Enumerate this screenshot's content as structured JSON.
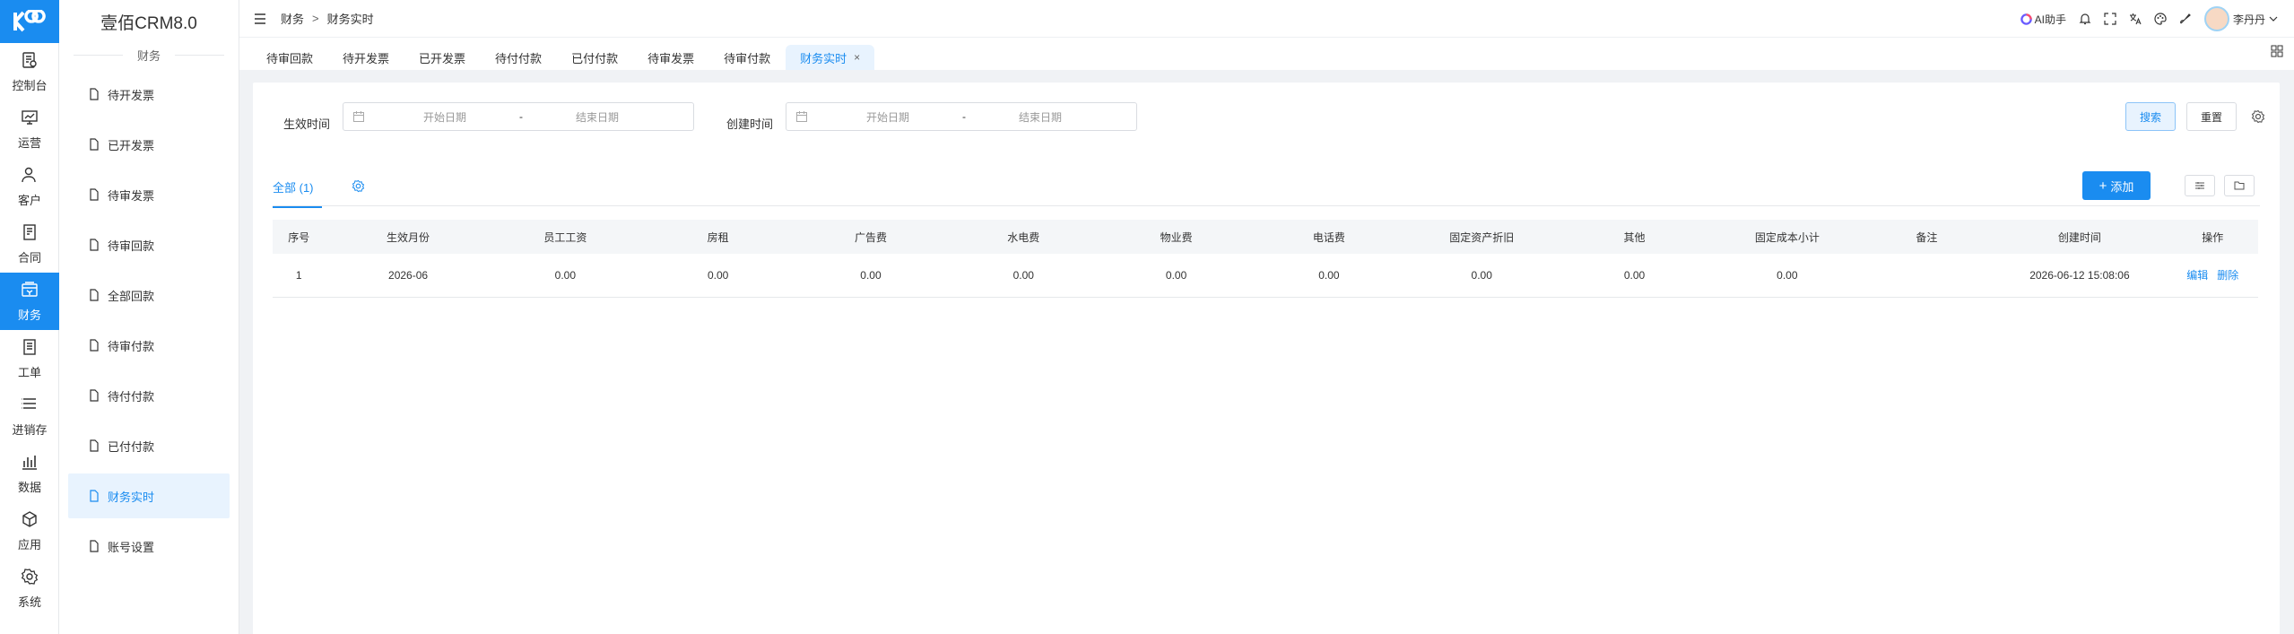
{
  "rail": {
    "items": [
      {
        "label": "控制台",
        "icon": "dashboard-icon"
      },
      {
        "label": "运营",
        "icon": "operations-icon"
      },
      {
        "label": "客户",
        "icon": "customer-icon"
      },
      {
        "label": "合同",
        "icon": "contract-icon"
      },
      {
        "label": "财务",
        "icon": "finance-icon",
        "active": true
      },
      {
        "label": "工单",
        "icon": "ticket-icon"
      },
      {
        "label": "进销存",
        "icon": "inventory-icon"
      },
      {
        "label": "数据",
        "icon": "data-icon"
      },
      {
        "label": "应用",
        "icon": "apps-icon"
      },
      {
        "label": "系统",
        "icon": "system-icon"
      }
    ]
  },
  "sub": {
    "brand": "壹佰CRM8.0",
    "title": "财务",
    "items": [
      {
        "label": "待开发票"
      },
      {
        "label": "已开发票"
      },
      {
        "label": "待审发票"
      },
      {
        "label": "待审回款"
      },
      {
        "label": "全部回款"
      },
      {
        "label": "待审付款"
      },
      {
        "label": "待付付款"
      },
      {
        "label": "已付付款"
      },
      {
        "label": "财务实时",
        "active": true
      },
      {
        "label": "账号设置"
      }
    ]
  },
  "header": {
    "breadcrumb": [
      "财务",
      "财务实时"
    ],
    "breadcrumb_sep": ">",
    "ai_label": "AI助手",
    "user_name": "李丹丹"
  },
  "tabs": {
    "items": [
      "待审回款",
      "待开发票",
      "已开发票",
      "待付付款",
      "已付付款",
      "待审发票",
      "待审付款",
      "财务实时"
    ],
    "close_glyph": "×"
  },
  "filter": {
    "effective_label": "生效时间",
    "created_label": "创建时间",
    "start_placeholder": "开始日期",
    "end_placeholder": "结束日期",
    "range_sep": "-",
    "search_label": "搜索",
    "reset_label": "重置"
  },
  "list": {
    "tab_label": "全部 (1)",
    "add_label": "添加",
    "columns": [
      "序号",
      "生效月份",
      "员工工资",
      "房租",
      "广告费",
      "水电费",
      "物业费",
      "电话费",
      "固定资产折旧",
      "其他",
      "固定成本小计",
      "备注",
      "创建时间",
      "操作"
    ],
    "rows": [
      {
        "cells": [
          "1",
          "2026-06",
          "0.00",
          "0.00",
          "0.00",
          "0.00",
          "0.00",
          "0.00",
          "0.00",
          "0.00",
          "0.00",
          "",
          "2026-06-12 15:08:06"
        ],
        "edit": "编辑",
        "delete": "删除"
      }
    ]
  },
  "colors": {
    "accent": "#1a8cf0",
    "active_bg": "#e8f3fe"
  }
}
